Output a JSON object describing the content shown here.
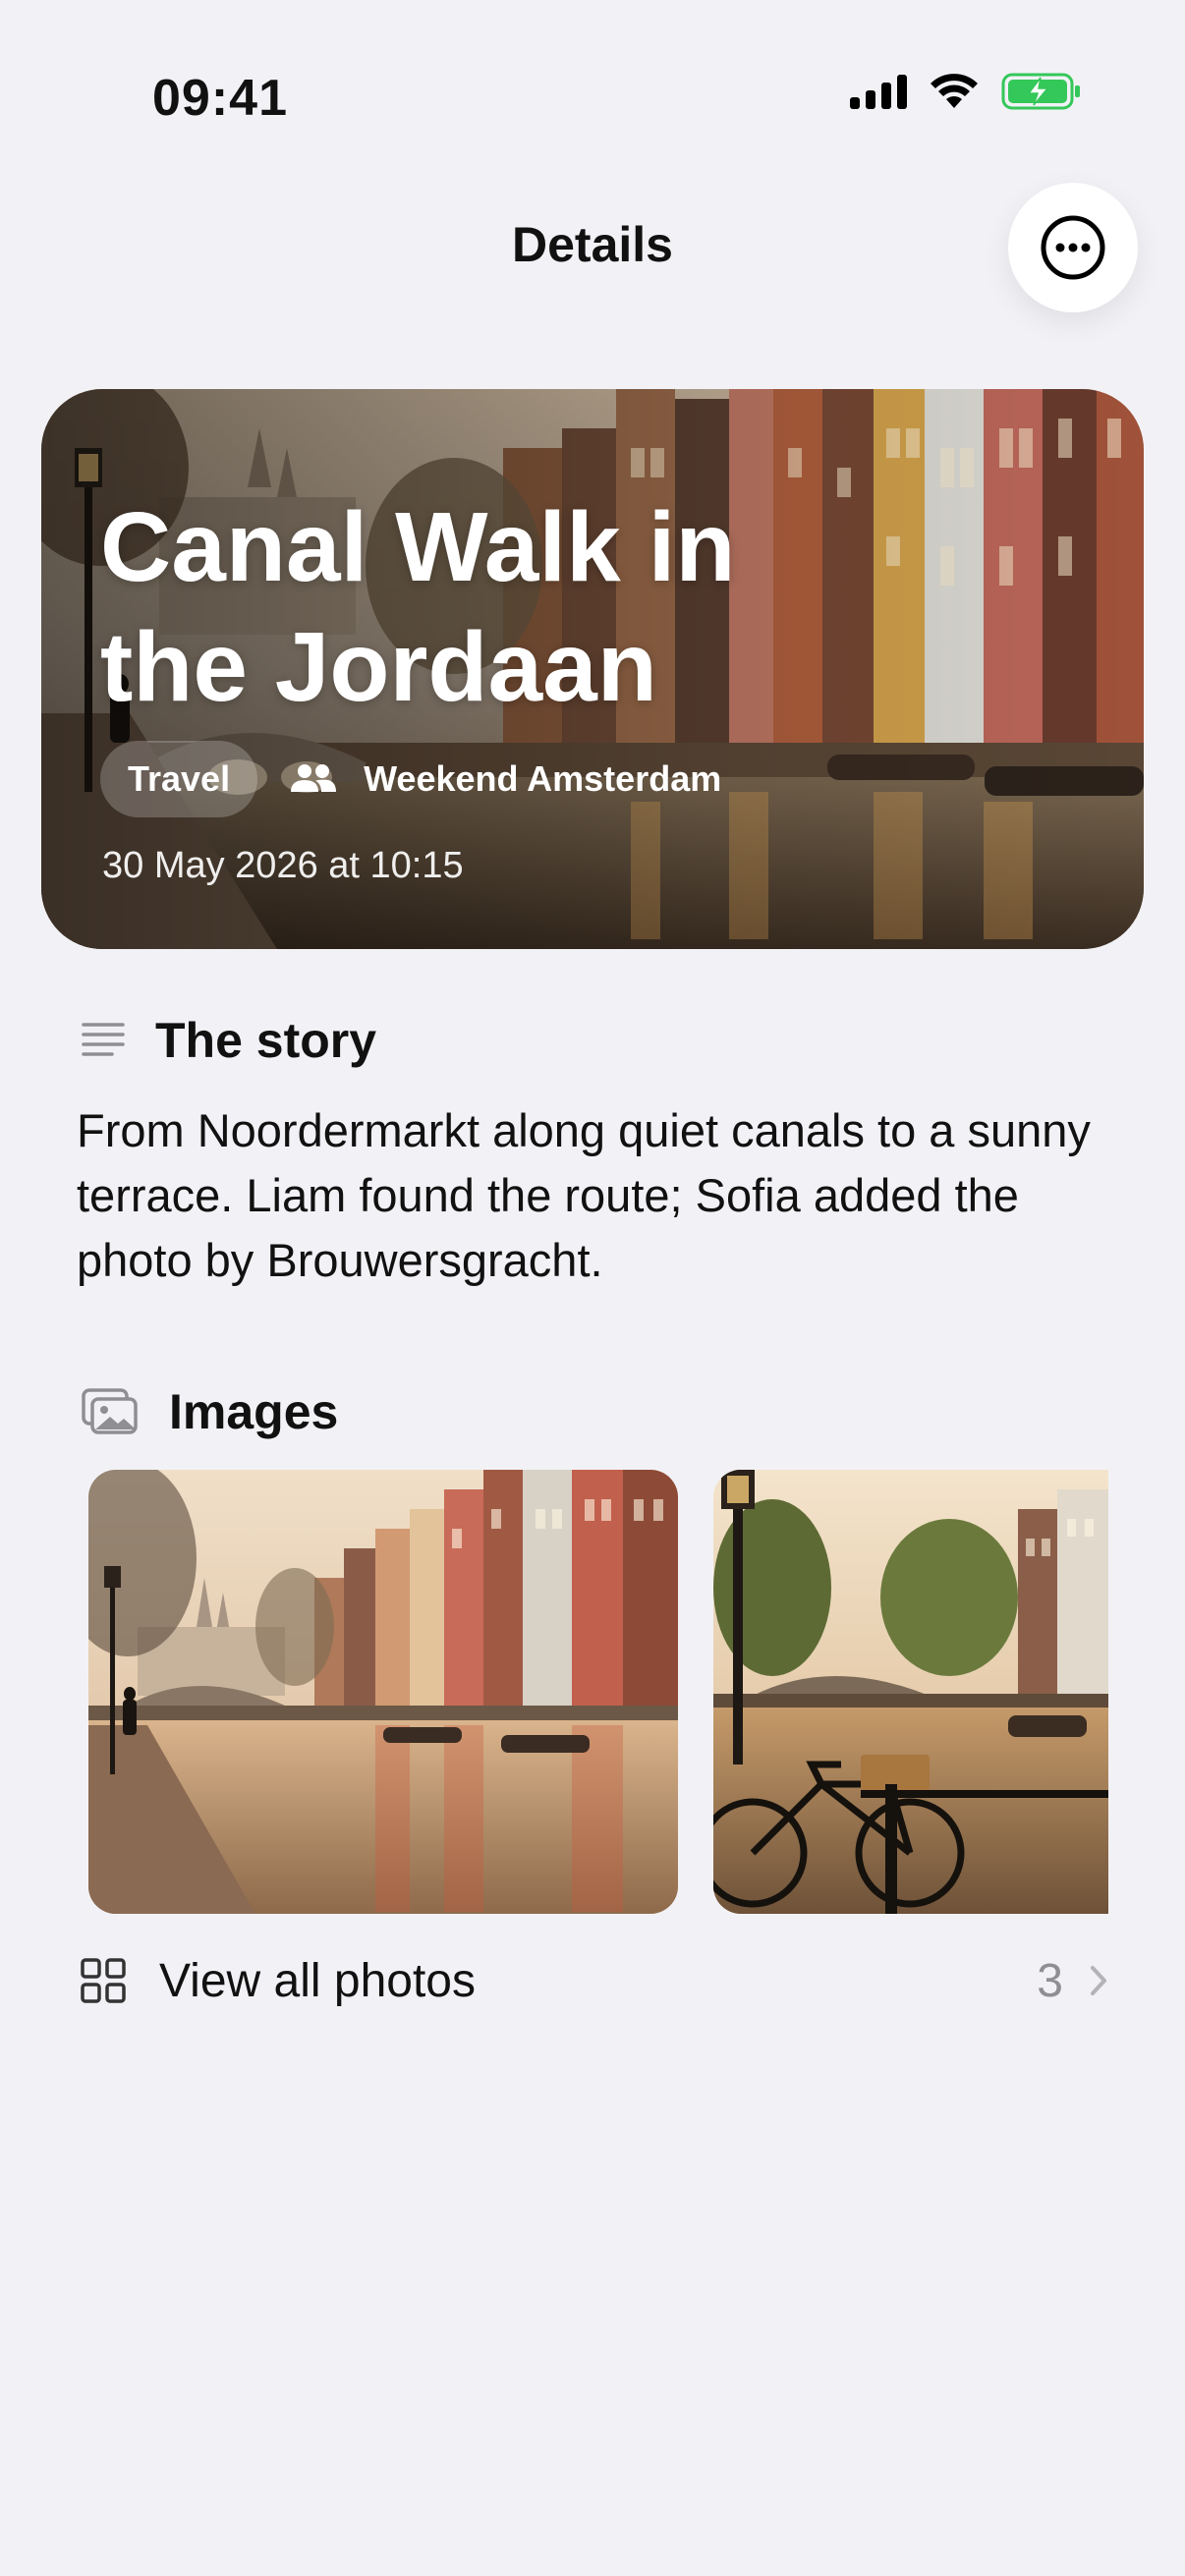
{
  "status_bar": {
    "time": "09:41"
  },
  "nav": {
    "title": "Details"
  },
  "hero": {
    "title": "Canal Walk in the Jordaan",
    "category": "Travel",
    "group": "Weekend Amsterdam",
    "date": "30 May 2026 at 10:15"
  },
  "story": {
    "heading": "The story",
    "text": "From Noordermarkt along quiet canals to a sunny terrace. Liam found the route; Sofia added the photo by Brouwersgracht."
  },
  "images": {
    "heading": "Images",
    "view_all_label": "View all photos",
    "count": "3"
  },
  "colors": {
    "background": "#f2f2f6",
    "accent_battery": "#34c759",
    "muted": "#8e8e93"
  }
}
